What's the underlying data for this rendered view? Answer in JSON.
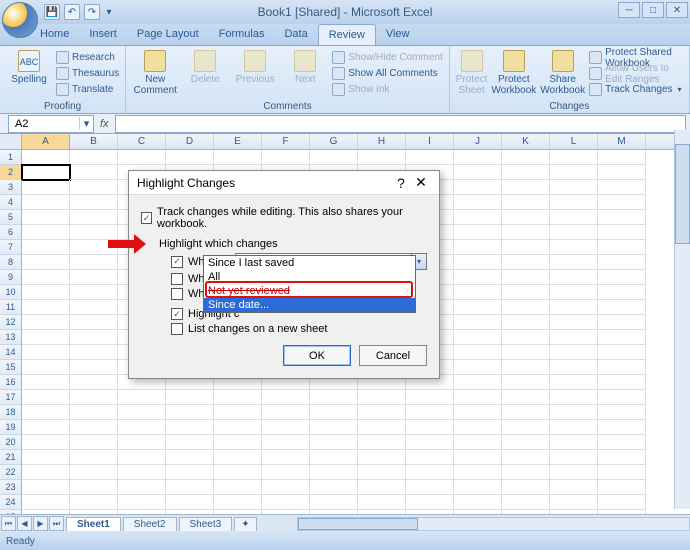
{
  "title": "Book1 [Shared] - Microsoft Excel",
  "tabs": [
    "Home",
    "Insert",
    "Page Layout",
    "Formulas",
    "Data",
    "Review",
    "View"
  ],
  "active_tab": "Review",
  "ribbon": {
    "proofing": {
      "label": "Proofing",
      "spelling": "Spelling",
      "research": "Research",
      "thesaurus": "Thesaurus",
      "translate": "Translate"
    },
    "comments": {
      "label": "Comments",
      "new": "New Comment",
      "delete": "Delete",
      "previous": "Previous",
      "next": "Next",
      "showhide": "Show/Hide Comment",
      "showall": "Show All Comments",
      "showink": "Show Ink"
    },
    "changes": {
      "label": "Changes",
      "protect_sheet": "Protect Sheet",
      "protect_wb": "Protect Workbook",
      "share_wb": "Share Workbook",
      "protect_share": "Protect Shared Workbook",
      "allow_ranges": "Allow Users to Edit Ranges",
      "track": "Track Changes"
    }
  },
  "namebox": "A2",
  "fx": "fx",
  "columns": [
    "A",
    "B",
    "C",
    "D",
    "E",
    "F",
    "G",
    "H",
    "I",
    "J",
    "K",
    "L",
    "M"
  ],
  "row_count": 26,
  "selected": {
    "row": 2,
    "col": "A"
  },
  "sheets": [
    "Sheet1",
    "Sheet2",
    "Sheet3"
  ],
  "active_sheet": "Sheet1",
  "status": "Ready",
  "dialog": {
    "title": "Highlight Changes",
    "track": "Track changes while editing. This also shares your workbook.",
    "which": "Highlight which changes",
    "when": "When:",
    "when_val": "All",
    "who": "Who:",
    "where": "Where:",
    "hl_screen": "Highlight c",
    "list_sheet": "List changes on a new sheet",
    "ok": "OK",
    "cancel": "Cancel",
    "options": {
      "o1": "Since I last saved",
      "o2": "All",
      "o3": "Not yet reviewed",
      "o4": "Since date..."
    }
  }
}
